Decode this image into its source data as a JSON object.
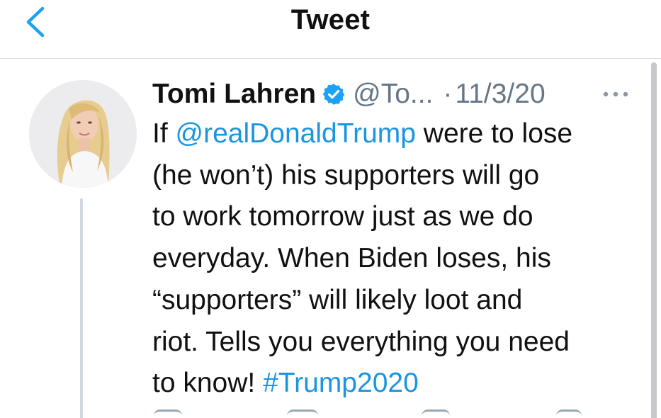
{
  "header": {
    "title": "Tweet",
    "back_icon": "chevron-left-icon"
  },
  "tweet": {
    "display_name": "Tomi Lahren",
    "verified_icon": "verified-badge-icon",
    "handle": "@To...",
    "separator": "·",
    "date": "11/3/20",
    "more_icon": "more-horizontal-icon",
    "text_lines": [
      {
        "before": "If ",
        "mention": "@realDonaldTrump",
        "after": " were to lose"
      },
      {
        "text": "(he won’t) his supporters will go"
      },
      {
        "text": "to work tomorrow just as we do"
      },
      {
        "text": "everyday. When Biden loses, his"
      },
      {
        "text": "“supporters” will likely loot and"
      },
      {
        "text": "riot. Tells you everything you need"
      },
      {
        "before": "to know! ",
        "hashtag": "#Trump2020"
      }
    ]
  },
  "colors": {
    "link": "#1b95e0",
    "secondary_text": "#657786",
    "primary_text": "#111111",
    "accent_blue": "#1da1f2"
  }
}
